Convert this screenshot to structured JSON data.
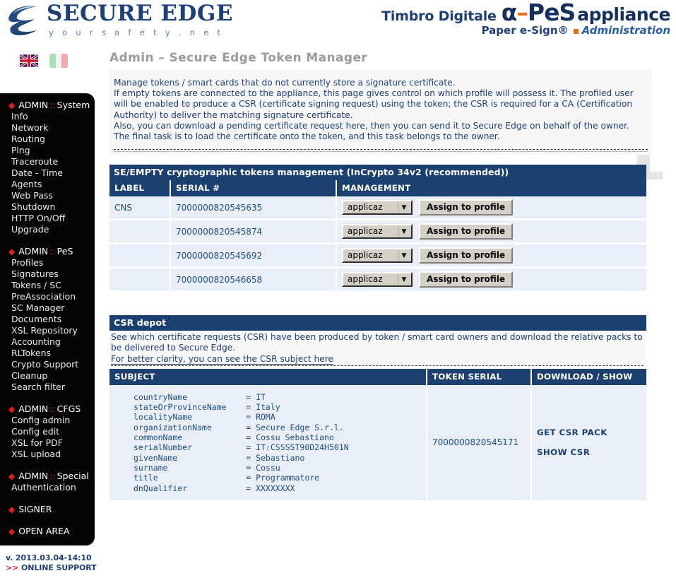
{
  "brand": {
    "name": "SECURE EDGE",
    "tagline": "y o u r   s a f e t y   . n e t",
    "logo_icon": "secure-edge-swoosh-logo"
  },
  "product": {
    "timbro": "Timbro Digitale",
    "alpha": "α",
    "dash": "–",
    "pes": "PeS",
    "appliance": "appliance",
    "paper_esign": "Paper e-Sign®",
    "administration": "Administration"
  },
  "flags": [
    {
      "name": "flag-en",
      "label": "English"
    },
    {
      "name": "flag-it",
      "label": "Italiano"
    }
  ],
  "sidebar": {
    "groups": [
      {
        "head_prefix": "ADMIN",
        "head_sep": "::",
        "head_word": "System",
        "items": [
          "Info",
          "Network",
          "Routing",
          "Ping",
          "Traceroute",
          "Date - Time",
          "Agents",
          "Web Pass",
          "Shutdown",
          "HTTP On/Off",
          "Upgrade"
        ]
      },
      {
        "head_prefix": "ADMIN",
        "head_sep": "::",
        "head_word": "PeS",
        "items": [
          "Profiles",
          "Signatures",
          "Tokens / SC",
          "PreAssociation",
          "SC Manager",
          "Documents",
          "XSL Repository",
          "Accounting",
          "RLTokens",
          "Crypto Support",
          "Cleanup",
          "Search filter"
        ]
      },
      {
        "head_prefix": "ADMIN",
        "head_sep": "::",
        "head_word": "CFGS",
        "items": [
          "Config admin",
          "Config edit",
          "XSL for PDF",
          "XSL upload"
        ]
      },
      {
        "head_prefix": "ADMIN",
        "head_sep": "::",
        "head_word": "Special",
        "items": [
          "Authentication"
        ]
      },
      {
        "head_prefix": "SIGNER",
        "head_sep": "",
        "head_word": "",
        "items": []
      },
      {
        "head_prefix": "OPEN AREA",
        "head_sep": "",
        "head_word": "",
        "items": []
      }
    ],
    "version": "v. 2013.03.04-14:10",
    "support_arrows": ">>",
    "support_label": "ONLINE SUPPORT"
  },
  "page": {
    "title": "Admin – Secure Edge Token Manager",
    "watermark": "i",
    "intro_lines": [
      "Manage tokens / smart cards that do not currently store a signature certificate.",
      "If empty tokens are connected to the appliance, this page gives control on which profile will possess it. The profiled user will be enabled to produce a CSR (certificate signing request) using the token; the CSR is required for a CA (Certification Authority) to deliver the matching signature certificate.",
      "Also, you can download a pending certificate request here, then you can send it to Secure Edge on behalf of the owner.",
      "The final task is to load the certificate onto the token, and this task belongs to the owner."
    ]
  },
  "tokens_section": {
    "bar_title": "SE/EMPTY cryptographic tokens management (InCrypto 34v2 (recommended))",
    "columns": [
      "LABEL",
      "SERIAL #",
      "MANAGEMENT"
    ],
    "rows": [
      {
        "label": "CNS",
        "serial": "7000000820545635",
        "select_value": "applicaz",
        "button": "Assign to profile"
      },
      {
        "label": "",
        "serial": "7000000820545874",
        "select_value": "applicaz",
        "button": "Assign to profile"
      },
      {
        "label": "",
        "serial": "7000000820545692",
        "select_value": "applicaz",
        "button": "Assign to profile"
      },
      {
        "label": "",
        "serial": "7000000820546658",
        "select_value": "applicaz",
        "button": "Assign to profile"
      }
    ]
  },
  "csr_section": {
    "bar_title": "CSR depot",
    "note_line1": "See which certificate requests (CSR) have been produced by token / smart card owners and download the relative packs to be delivered to Secure Edge.",
    "note_link": "For better clarity, you can see the CSR subject here",
    "columns": [
      "SUBJECT",
      "TOKEN SERIAL",
      "DOWNLOAD / SHOW"
    ],
    "rows": [
      {
        "subject": "countryName            = IT\nstateOrProvinceName    = Italy\nlocalityName           = ROMA\norganizationName       = Secure Edge S.r.l.\ncommonName             = Cossu Sebastiano\nserialNumber           = IT:CSSSST90D24H501N\ngivenName              = Sebastiano\nsurname                = Cossu\ntitle                  = Programmatore\ndnQualifier            = XXXXXXXX",
        "token_serial": "7000000820545171",
        "get_pack": "GET CSR PACK",
        "show_csr": "SHOW CSR"
      }
    ]
  },
  "colors": {
    "brand_blue": "#1f3f77",
    "bar_blue": "#1b3f6e",
    "row_blue": "#e9eef7",
    "accent_orange": "#e8701a",
    "sidebar_black": "#050505",
    "diamond_red": "#e02020"
  }
}
